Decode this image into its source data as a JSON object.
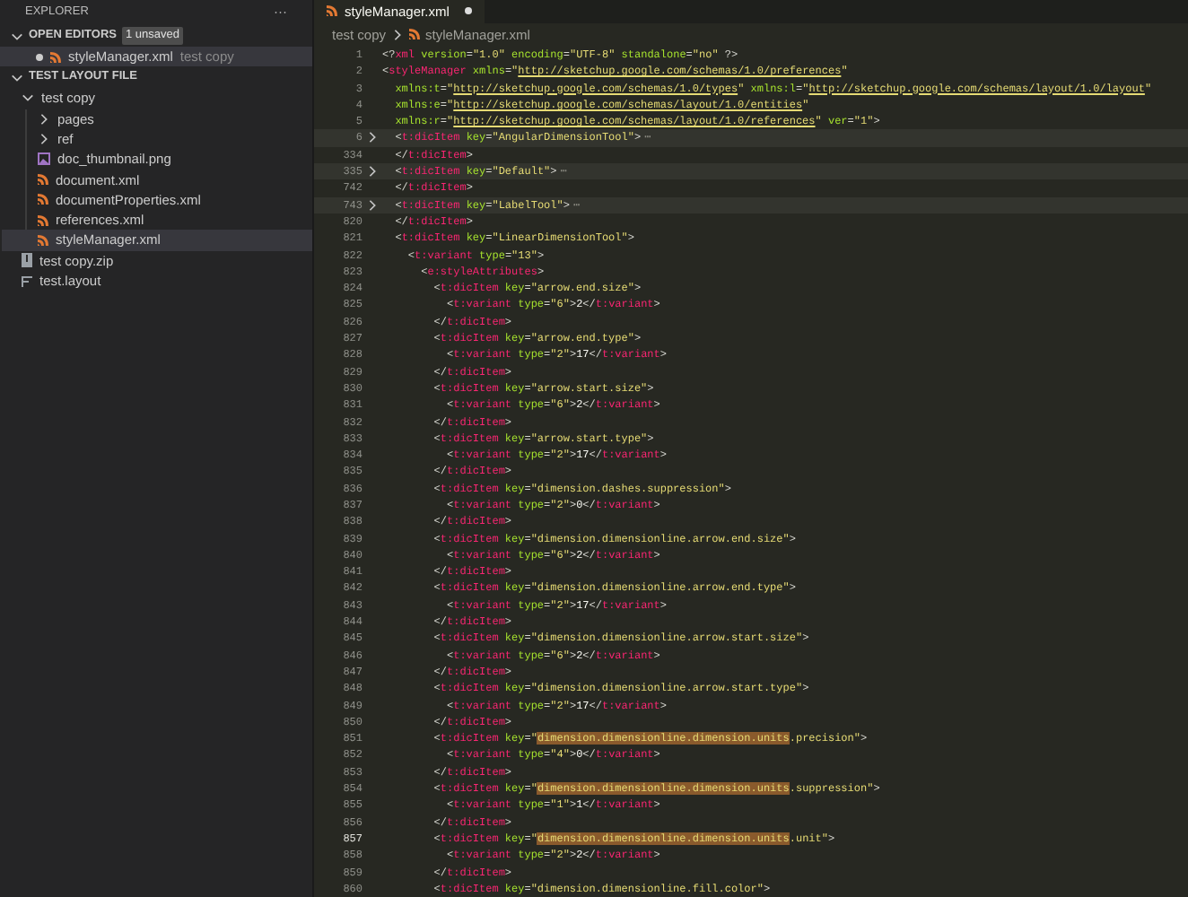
{
  "sidebar": {
    "title": "EXPLORER",
    "more": "···",
    "open_editors": {
      "title": "OPEN EDITORS",
      "expanded": true,
      "badge": "1 unsaved",
      "items": [
        {
          "name": "styleManager.xml",
          "folder": "test copy",
          "modified": true,
          "selected": true
        }
      ]
    },
    "workspace": {
      "title": "TEST LAYOUT FILE",
      "expanded": true,
      "tree": [
        {
          "name": "test copy",
          "kind": "folder",
          "expanded": true,
          "selected": false,
          "children": [
            {
              "name": "pages",
              "kind": "folder",
              "expanded": false,
              "selected": false
            },
            {
              "name": "ref",
              "kind": "folder",
              "expanded": false,
              "selected": false
            },
            {
              "name": "doc_thumbnail.png",
              "kind": "image",
              "selected": false
            },
            {
              "name": "document.xml",
              "kind": "xml",
              "selected": false
            },
            {
              "name": "documentProperties.xml",
              "kind": "xml",
              "selected": false
            },
            {
              "name": "references.xml",
              "kind": "xml",
              "selected": false
            },
            {
              "name": "styleManager.xml",
              "kind": "xml",
              "selected": true
            }
          ]
        },
        {
          "name": "test copy.zip",
          "kind": "zip",
          "selected": false
        },
        {
          "name": "test.layout",
          "kind": "file",
          "selected": false
        }
      ]
    }
  },
  "tabs": [
    {
      "label": "styleManager.xml",
      "selected": true,
      "modified": true
    }
  ],
  "breadcrumb": [
    "test copy",
    "styleManager.xml"
  ],
  "code": [
    {
      "n": "1",
      "folded": false,
      "current": false,
      "c": [
        {
          "kind": "p",
          "text": "<?"
        },
        {
          "kind": "tag",
          "text": "xml"
        },
        {
          "kind": "attr",
          "text": " version"
        },
        {
          "kind": "p",
          "text": "="
        },
        {
          "kind": "str",
          "text": "\"1.0\""
        },
        {
          "kind": "attr",
          "text": " encoding"
        },
        {
          "kind": "p",
          "text": "="
        },
        {
          "kind": "str",
          "text": "\"UTF-8\""
        },
        {
          "kind": "attr",
          "text": " standalone"
        },
        {
          "kind": "p",
          "text": "="
        },
        {
          "kind": "str",
          "text": "\"no\""
        },
        {
          "kind": "p",
          "text": " ?>"
        }
      ]
    },
    {
      "n": "2",
      "folded": false,
      "current": false,
      "c": [
        {
          "kind": "p",
          "text": "<"
        },
        {
          "kind": "tag",
          "text": "styleManager"
        },
        {
          "kind": "attr",
          "text": " xmlns"
        },
        {
          "kind": "p",
          "text": "="
        },
        {
          "kind": "str",
          "text": "\""
        },
        {
          "kind": "link",
          "text": "http://sketchup.google.com/schemas/1.0/preferences"
        },
        {
          "kind": "str",
          "text": "\""
        }
      ]
    },
    {
      "n": "3",
      "folded": false,
      "current": false,
      "c": [
        {
          "kind": "attr",
          "text": "  xmlns:t"
        },
        {
          "kind": "p",
          "text": "="
        },
        {
          "kind": "str",
          "text": "\""
        },
        {
          "kind": "link",
          "text": "http://sketchup.google.com/schemas/1.0/types"
        },
        {
          "kind": "str",
          "text": "\""
        },
        {
          "kind": "attr",
          "text": " xmlns:l"
        },
        {
          "kind": "p",
          "text": "="
        },
        {
          "kind": "str",
          "text": "\""
        },
        {
          "kind": "link",
          "text": "http://sketchup.google.com/schemas/layout/1.0/layout"
        },
        {
          "kind": "str",
          "text": "\""
        }
      ]
    },
    {
      "n": "4",
      "folded": false,
      "current": false,
      "c": [
        {
          "kind": "attr",
          "text": "  xmlns:e"
        },
        {
          "kind": "p",
          "text": "="
        },
        {
          "kind": "str",
          "text": "\""
        },
        {
          "kind": "link",
          "text": "http://sketchup.google.com/schemas/layout/1.0/entities"
        },
        {
          "kind": "str",
          "text": "\""
        }
      ]
    },
    {
      "n": "5",
      "folded": false,
      "current": false,
      "c": [
        {
          "kind": "attr",
          "text": "  xmlns:r"
        },
        {
          "kind": "p",
          "text": "="
        },
        {
          "kind": "str",
          "text": "\""
        },
        {
          "kind": "link",
          "text": "http://sketchup.google.com/schemas/layout/1.0/references"
        },
        {
          "kind": "str",
          "text": "\""
        },
        {
          "kind": "attr",
          "text": " ver"
        },
        {
          "kind": "p",
          "text": "="
        },
        {
          "kind": "str",
          "text": "\"1\""
        },
        {
          "kind": "p",
          "text": ">"
        }
      ]
    },
    {
      "n": "6",
      "folded": true,
      "current": false,
      "c": [
        {
          "kind": "p",
          "text": "  <"
        },
        {
          "kind": "tag",
          "text": "t:dicItem"
        },
        {
          "kind": "attr",
          "text": " key"
        },
        {
          "kind": "p",
          "text": "="
        },
        {
          "kind": "str",
          "text": "\"AngularDimensionTool\""
        },
        {
          "kind": "p",
          "text": ">"
        },
        {
          "kind": "fold",
          "text": "⋯"
        }
      ]
    },
    {
      "n": "334",
      "folded": false,
      "current": false,
      "c": [
        {
          "kind": "p",
          "text": "  </"
        },
        {
          "kind": "tag",
          "text": "t:dicItem"
        },
        {
          "kind": "p",
          "text": ">"
        }
      ]
    },
    {
      "n": "335",
      "folded": true,
      "current": false,
      "c": [
        {
          "kind": "p",
          "text": "  <"
        },
        {
          "kind": "tag",
          "text": "t:dicItem"
        },
        {
          "kind": "attr",
          "text": " key"
        },
        {
          "kind": "p",
          "text": "="
        },
        {
          "kind": "str",
          "text": "\"Default\""
        },
        {
          "kind": "p",
          "text": ">"
        },
        {
          "kind": "fold",
          "text": "⋯"
        }
      ]
    },
    {
      "n": "742",
      "folded": false,
      "current": false,
      "c": [
        {
          "kind": "p",
          "text": "  </"
        },
        {
          "kind": "tag",
          "text": "t:dicItem"
        },
        {
          "kind": "p",
          "text": ">"
        }
      ]
    },
    {
      "n": "743",
      "folded": true,
      "current": false,
      "c": [
        {
          "kind": "p",
          "text": "  <"
        },
        {
          "kind": "tag",
          "text": "t:dicItem"
        },
        {
          "kind": "attr",
          "text": " key"
        },
        {
          "kind": "p",
          "text": "="
        },
        {
          "kind": "str",
          "text": "\"LabelTool\""
        },
        {
          "kind": "p",
          "text": ">"
        },
        {
          "kind": "fold",
          "text": "⋯"
        }
      ]
    },
    {
      "n": "820",
      "folded": false,
      "current": false,
      "c": [
        {
          "kind": "p",
          "text": "  </"
        },
        {
          "kind": "tag",
          "text": "t:dicItem"
        },
        {
          "kind": "p",
          "text": ">"
        }
      ]
    },
    {
      "n": "821",
      "folded": false,
      "current": false,
      "c": [
        {
          "kind": "p",
          "text": "  <"
        },
        {
          "kind": "tag",
          "text": "t:dicItem"
        },
        {
          "kind": "attr",
          "text": " key"
        },
        {
          "kind": "p",
          "text": "="
        },
        {
          "kind": "str",
          "text": "\"LinearDimensionTool\""
        },
        {
          "kind": "p",
          "text": ">"
        }
      ]
    },
    {
      "n": "822",
      "folded": false,
      "current": false,
      "c": [
        {
          "kind": "p",
          "text": "    <"
        },
        {
          "kind": "tag",
          "text": "t:variant"
        },
        {
          "kind": "attr",
          "text": " type"
        },
        {
          "kind": "p",
          "text": "="
        },
        {
          "kind": "str",
          "text": "\"13\""
        },
        {
          "kind": "p",
          "text": ">"
        }
      ]
    },
    {
      "n": "823",
      "folded": false,
      "current": false,
      "c": [
        {
          "kind": "p",
          "text": "      <"
        },
        {
          "kind": "tag",
          "text": "e:styleAttributes"
        },
        {
          "kind": "p",
          "text": ">"
        }
      ]
    },
    {
      "n": "824",
      "folded": false,
      "current": false,
      "c": [
        {
          "kind": "p",
          "text": "        <"
        },
        {
          "kind": "tag",
          "text": "t:dicItem"
        },
        {
          "kind": "attr",
          "text": " key"
        },
        {
          "kind": "p",
          "text": "="
        },
        {
          "kind": "str",
          "text": "\"arrow.end.size\""
        },
        {
          "kind": "p",
          "text": ">"
        }
      ]
    },
    {
      "n": "825",
      "folded": false,
      "current": false,
      "c": [
        {
          "kind": "p",
          "text": "          <"
        },
        {
          "kind": "tag",
          "text": "t:variant"
        },
        {
          "kind": "attr",
          "text": " type"
        },
        {
          "kind": "p",
          "text": "="
        },
        {
          "kind": "str",
          "text": "\"6\""
        },
        {
          "kind": "p",
          "text": ">"
        },
        {
          "kind": "text",
          "text": "2"
        },
        {
          "kind": "p",
          "text": "</"
        },
        {
          "kind": "tag",
          "text": "t:variant"
        },
        {
          "kind": "p",
          "text": ">"
        }
      ]
    },
    {
      "n": "826",
      "folded": false,
      "current": false,
      "c": [
        {
          "kind": "p",
          "text": "        </"
        },
        {
          "kind": "tag",
          "text": "t:dicItem"
        },
        {
          "kind": "p",
          "text": ">"
        }
      ]
    },
    {
      "n": "827",
      "folded": false,
      "current": false,
      "c": [
        {
          "kind": "p",
          "text": "        <"
        },
        {
          "kind": "tag",
          "text": "t:dicItem"
        },
        {
          "kind": "attr",
          "text": " key"
        },
        {
          "kind": "p",
          "text": "="
        },
        {
          "kind": "str",
          "text": "\"arrow.end.type\""
        },
        {
          "kind": "p",
          "text": ">"
        }
      ]
    },
    {
      "n": "828",
      "folded": false,
      "current": false,
      "c": [
        {
          "kind": "p",
          "text": "          <"
        },
        {
          "kind": "tag",
          "text": "t:variant"
        },
        {
          "kind": "attr",
          "text": " type"
        },
        {
          "kind": "p",
          "text": "="
        },
        {
          "kind": "str",
          "text": "\"2\""
        },
        {
          "kind": "p",
          "text": ">"
        },
        {
          "kind": "text",
          "text": "17"
        },
        {
          "kind": "p",
          "text": "</"
        },
        {
          "kind": "tag",
          "text": "t:variant"
        },
        {
          "kind": "p",
          "text": ">"
        }
      ]
    },
    {
      "n": "829",
      "folded": false,
      "current": false,
      "c": [
        {
          "kind": "p",
          "text": "        </"
        },
        {
          "kind": "tag",
          "text": "t:dicItem"
        },
        {
          "kind": "p",
          "text": ">"
        }
      ]
    },
    {
      "n": "830",
      "folded": false,
      "current": false,
      "c": [
        {
          "kind": "p",
          "text": "        <"
        },
        {
          "kind": "tag",
          "text": "t:dicItem"
        },
        {
          "kind": "attr",
          "text": " key"
        },
        {
          "kind": "p",
          "text": "="
        },
        {
          "kind": "str",
          "text": "\"arrow.start.size\""
        },
        {
          "kind": "p",
          "text": ">"
        }
      ]
    },
    {
      "n": "831",
      "folded": false,
      "current": false,
      "c": [
        {
          "kind": "p",
          "text": "          <"
        },
        {
          "kind": "tag",
          "text": "t:variant"
        },
        {
          "kind": "attr",
          "text": " type"
        },
        {
          "kind": "p",
          "text": "="
        },
        {
          "kind": "str",
          "text": "\"6\""
        },
        {
          "kind": "p",
          "text": ">"
        },
        {
          "kind": "text",
          "text": "2"
        },
        {
          "kind": "p",
          "text": "</"
        },
        {
          "kind": "tag",
          "text": "t:variant"
        },
        {
          "kind": "p",
          "text": ">"
        }
      ]
    },
    {
      "n": "832",
      "folded": false,
      "current": false,
      "c": [
        {
          "kind": "p",
          "text": "        </"
        },
        {
          "kind": "tag",
          "text": "t:dicItem"
        },
        {
          "kind": "p",
          "text": ">"
        }
      ]
    },
    {
      "n": "833",
      "folded": false,
      "current": false,
      "c": [
        {
          "kind": "p",
          "text": "        <"
        },
        {
          "kind": "tag",
          "text": "t:dicItem"
        },
        {
          "kind": "attr",
          "text": " key"
        },
        {
          "kind": "p",
          "text": "="
        },
        {
          "kind": "str",
          "text": "\"arrow.start.type\""
        },
        {
          "kind": "p",
          "text": ">"
        }
      ]
    },
    {
      "n": "834",
      "folded": false,
      "current": false,
      "c": [
        {
          "kind": "p",
          "text": "          <"
        },
        {
          "kind": "tag",
          "text": "t:variant"
        },
        {
          "kind": "attr",
          "text": " type"
        },
        {
          "kind": "p",
          "text": "="
        },
        {
          "kind": "str",
          "text": "\"2\""
        },
        {
          "kind": "p",
          "text": ">"
        },
        {
          "kind": "text",
          "text": "17"
        },
        {
          "kind": "p",
          "text": "</"
        },
        {
          "kind": "tag",
          "text": "t:variant"
        },
        {
          "kind": "p",
          "text": ">"
        }
      ]
    },
    {
      "n": "835",
      "folded": false,
      "current": false,
      "c": [
        {
          "kind": "p",
          "text": "        </"
        },
        {
          "kind": "tag",
          "text": "t:dicItem"
        },
        {
          "kind": "p",
          "text": ">"
        }
      ]
    },
    {
      "n": "836",
      "folded": false,
      "current": false,
      "c": [
        {
          "kind": "p",
          "text": "        <"
        },
        {
          "kind": "tag",
          "text": "t:dicItem"
        },
        {
          "kind": "attr",
          "text": " key"
        },
        {
          "kind": "p",
          "text": "="
        },
        {
          "kind": "str",
          "text": "\"dimension.dashes.suppression\""
        },
        {
          "kind": "p",
          "text": ">"
        }
      ]
    },
    {
      "n": "837",
      "folded": false,
      "current": false,
      "c": [
        {
          "kind": "p",
          "text": "          <"
        },
        {
          "kind": "tag",
          "text": "t:variant"
        },
        {
          "kind": "attr",
          "text": " type"
        },
        {
          "kind": "p",
          "text": "="
        },
        {
          "kind": "str",
          "text": "\"2\""
        },
        {
          "kind": "p",
          "text": ">"
        },
        {
          "kind": "text",
          "text": "0"
        },
        {
          "kind": "p",
          "text": "</"
        },
        {
          "kind": "tag",
          "text": "t:variant"
        },
        {
          "kind": "p",
          "text": ">"
        }
      ]
    },
    {
      "n": "838",
      "folded": false,
      "current": false,
      "c": [
        {
          "kind": "p",
          "text": "        </"
        },
        {
          "kind": "tag",
          "text": "t:dicItem"
        },
        {
          "kind": "p",
          "text": ">"
        }
      ]
    },
    {
      "n": "839",
      "folded": false,
      "current": false,
      "c": [
        {
          "kind": "p",
          "text": "        <"
        },
        {
          "kind": "tag",
          "text": "t:dicItem"
        },
        {
          "kind": "attr",
          "text": " key"
        },
        {
          "kind": "p",
          "text": "="
        },
        {
          "kind": "str",
          "text": "\"dimension.dimensionline.arrow.end.size\""
        },
        {
          "kind": "p",
          "text": ">"
        }
      ]
    },
    {
      "n": "840",
      "folded": false,
      "current": false,
      "c": [
        {
          "kind": "p",
          "text": "          <"
        },
        {
          "kind": "tag",
          "text": "t:variant"
        },
        {
          "kind": "attr",
          "text": " type"
        },
        {
          "kind": "p",
          "text": "="
        },
        {
          "kind": "str",
          "text": "\"6\""
        },
        {
          "kind": "p",
          "text": ">"
        },
        {
          "kind": "text",
          "text": "2"
        },
        {
          "kind": "p",
          "text": "</"
        },
        {
          "kind": "tag",
          "text": "t:variant"
        },
        {
          "kind": "p",
          "text": ">"
        }
      ]
    },
    {
      "n": "841",
      "folded": false,
      "current": false,
      "c": [
        {
          "kind": "p",
          "text": "        </"
        },
        {
          "kind": "tag",
          "text": "t:dicItem"
        },
        {
          "kind": "p",
          "text": ">"
        }
      ]
    },
    {
      "n": "842",
      "folded": false,
      "current": false,
      "c": [
        {
          "kind": "p",
          "text": "        <"
        },
        {
          "kind": "tag",
          "text": "t:dicItem"
        },
        {
          "kind": "attr",
          "text": " key"
        },
        {
          "kind": "p",
          "text": "="
        },
        {
          "kind": "str",
          "text": "\"dimension.dimensionline.arrow.end.type\""
        },
        {
          "kind": "p",
          "text": ">"
        }
      ]
    },
    {
      "n": "843",
      "folded": false,
      "current": false,
      "c": [
        {
          "kind": "p",
          "text": "          <"
        },
        {
          "kind": "tag",
          "text": "t:variant"
        },
        {
          "kind": "attr",
          "text": " type"
        },
        {
          "kind": "p",
          "text": "="
        },
        {
          "kind": "str",
          "text": "\"2\""
        },
        {
          "kind": "p",
          "text": ">"
        },
        {
          "kind": "text",
          "text": "17"
        },
        {
          "kind": "p",
          "text": "</"
        },
        {
          "kind": "tag",
          "text": "t:variant"
        },
        {
          "kind": "p",
          "text": ">"
        }
      ]
    },
    {
      "n": "844",
      "folded": false,
      "current": false,
      "c": [
        {
          "kind": "p",
          "text": "        </"
        },
        {
          "kind": "tag",
          "text": "t:dicItem"
        },
        {
          "kind": "p",
          "text": ">"
        }
      ]
    },
    {
      "n": "845",
      "folded": false,
      "current": false,
      "c": [
        {
          "kind": "p",
          "text": "        <"
        },
        {
          "kind": "tag",
          "text": "t:dicItem"
        },
        {
          "kind": "attr",
          "text": " key"
        },
        {
          "kind": "p",
          "text": "="
        },
        {
          "kind": "str",
          "text": "\"dimension.dimensionline.arrow.start.size\""
        },
        {
          "kind": "p",
          "text": ">"
        }
      ]
    },
    {
      "n": "846",
      "folded": false,
      "current": false,
      "c": [
        {
          "kind": "p",
          "text": "          <"
        },
        {
          "kind": "tag",
          "text": "t:variant"
        },
        {
          "kind": "attr",
          "text": " type"
        },
        {
          "kind": "p",
          "text": "="
        },
        {
          "kind": "str",
          "text": "\"6\""
        },
        {
          "kind": "p",
          "text": ">"
        },
        {
          "kind": "text",
          "text": "2"
        },
        {
          "kind": "p",
          "text": "</"
        },
        {
          "kind": "tag",
          "text": "t:variant"
        },
        {
          "kind": "p",
          "text": ">"
        }
      ]
    },
    {
      "n": "847",
      "folded": false,
      "current": false,
      "c": [
        {
          "kind": "p",
          "text": "        </"
        },
        {
          "kind": "tag",
          "text": "t:dicItem"
        },
        {
          "kind": "p",
          "text": ">"
        }
      ]
    },
    {
      "n": "848",
      "folded": false,
      "current": false,
      "c": [
        {
          "kind": "p",
          "text": "        <"
        },
        {
          "kind": "tag",
          "text": "t:dicItem"
        },
        {
          "kind": "attr",
          "text": " key"
        },
        {
          "kind": "p",
          "text": "="
        },
        {
          "kind": "str",
          "text": "\"dimension.dimensionline.arrow.start.type\""
        },
        {
          "kind": "p",
          "text": ">"
        }
      ]
    },
    {
      "n": "849",
      "folded": false,
      "current": false,
      "c": [
        {
          "kind": "p",
          "text": "          <"
        },
        {
          "kind": "tag",
          "text": "t:variant"
        },
        {
          "kind": "attr",
          "text": " type"
        },
        {
          "kind": "p",
          "text": "="
        },
        {
          "kind": "str",
          "text": "\"2\""
        },
        {
          "kind": "p",
          "text": ">"
        },
        {
          "kind": "text",
          "text": "17"
        },
        {
          "kind": "p",
          "text": "</"
        },
        {
          "kind": "tag",
          "text": "t:variant"
        },
        {
          "kind": "p",
          "text": ">"
        }
      ]
    },
    {
      "n": "850",
      "folded": false,
      "current": false,
      "c": [
        {
          "kind": "p",
          "text": "        </"
        },
        {
          "kind": "tag",
          "text": "t:dicItem"
        },
        {
          "kind": "p",
          "text": ">"
        }
      ]
    },
    {
      "n": "851",
      "folded": false,
      "current": false,
      "c": [
        {
          "kind": "p",
          "text": "        <"
        },
        {
          "kind": "tag",
          "text": "t:dicItem"
        },
        {
          "kind": "attr",
          "text": " key"
        },
        {
          "kind": "p",
          "text": "="
        },
        {
          "kind": "str",
          "text": "\""
        },
        {
          "kind": "match",
          "text": "dimension.dimensionline.dimension.units"
        },
        {
          "kind": "str",
          "text": ".precision\""
        },
        {
          "kind": "p",
          "text": ">"
        }
      ]
    },
    {
      "n": "852",
      "folded": false,
      "current": false,
      "c": [
        {
          "kind": "p",
          "text": "          <"
        },
        {
          "kind": "tag",
          "text": "t:variant"
        },
        {
          "kind": "attr",
          "text": " type"
        },
        {
          "kind": "p",
          "text": "="
        },
        {
          "kind": "str",
          "text": "\"4\""
        },
        {
          "kind": "p",
          "text": ">"
        },
        {
          "kind": "text",
          "text": "0"
        },
        {
          "kind": "p",
          "text": "</"
        },
        {
          "kind": "tag",
          "text": "t:variant"
        },
        {
          "kind": "p",
          "text": ">"
        }
      ]
    },
    {
      "n": "853",
      "folded": false,
      "current": false,
      "c": [
        {
          "kind": "p",
          "text": "        </"
        },
        {
          "kind": "tag",
          "text": "t:dicItem"
        },
        {
          "kind": "p",
          "text": ">"
        }
      ]
    },
    {
      "n": "854",
      "folded": false,
      "current": false,
      "c": [
        {
          "kind": "p",
          "text": "        <"
        },
        {
          "kind": "tag",
          "text": "t:dicItem"
        },
        {
          "kind": "attr",
          "text": " key"
        },
        {
          "kind": "p",
          "text": "="
        },
        {
          "kind": "str",
          "text": "\""
        },
        {
          "kind": "match",
          "text": "dimension.dimensionline.dimension.units"
        },
        {
          "kind": "str",
          "text": ".suppression\""
        },
        {
          "kind": "p",
          "text": ">"
        }
      ]
    },
    {
      "n": "855",
      "folded": false,
      "current": false,
      "c": [
        {
          "kind": "p",
          "text": "          <"
        },
        {
          "kind": "tag",
          "text": "t:variant"
        },
        {
          "kind": "attr",
          "text": " type"
        },
        {
          "kind": "p",
          "text": "="
        },
        {
          "kind": "str",
          "text": "\"1\""
        },
        {
          "kind": "p",
          "text": ">"
        },
        {
          "kind": "text",
          "text": "1"
        },
        {
          "kind": "p",
          "text": "</"
        },
        {
          "kind": "tag",
          "text": "t:variant"
        },
        {
          "kind": "p",
          "text": ">"
        }
      ]
    },
    {
      "n": "856",
      "folded": false,
      "current": false,
      "c": [
        {
          "kind": "p",
          "text": "        </"
        },
        {
          "kind": "tag",
          "text": "t:dicItem"
        },
        {
          "kind": "p",
          "text": ">"
        }
      ]
    },
    {
      "n": "857",
      "folded": false,
      "current": true,
      "c": [
        {
          "kind": "p",
          "text": "        <"
        },
        {
          "kind": "tag",
          "text": "t:dicItem"
        },
        {
          "kind": "attr",
          "text": " key"
        },
        {
          "kind": "p",
          "text": "="
        },
        {
          "kind": "str",
          "text": "\""
        },
        {
          "kind": "match",
          "text": "dimension.dimensionline.dimension.units"
        },
        {
          "kind": "str",
          "text": ".unit\""
        },
        {
          "kind": "p",
          "text": ">"
        }
      ]
    },
    {
      "n": "858",
      "folded": false,
      "current": false,
      "c": [
        {
          "kind": "p",
          "text": "          <"
        },
        {
          "kind": "tag",
          "text": "t:variant"
        },
        {
          "kind": "attr",
          "text": " type"
        },
        {
          "kind": "p",
          "text": "="
        },
        {
          "kind": "str",
          "text": "\"2\""
        },
        {
          "kind": "p",
          "text": ">"
        },
        {
          "kind": "text",
          "text": "2"
        },
        {
          "kind": "p",
          "text": "</"
        },
        {
          "kind": "tag",
          "text": "t:variant"
        },
        {
          "kind": "p",
          "text": ">"
        }
      ]
    },
    {
      "n": "859",
      "folded": false,
      "current": false,
      "c": [
        {
          "kind": "p",
          "text": "        </"
        },
        {
          "kind": "tag",
          "text": "t:dicItem"
        },
        {
          "kind": "p",
          "text": ">"
        }
      ]
    },
    {
      "n": "860",
      "folded": false,
      "current": false,
      "c": [
        {
          "kind": "p",
          "text": "        <"
        },
        {
          "kind": "tag",
          "text": "t:dicItem"
        },
        {
          "kind": "attr",
          "text": " key"
        },
        {
          "kind": "p",
          "text": "="
        },
        {
          "kind": "str",
          "text": "\"dimension.dimensionline.fill.color\""
        },
        {
          "kind": "p",
          "text": ">"
        }
      ]
    }
  ]
}
